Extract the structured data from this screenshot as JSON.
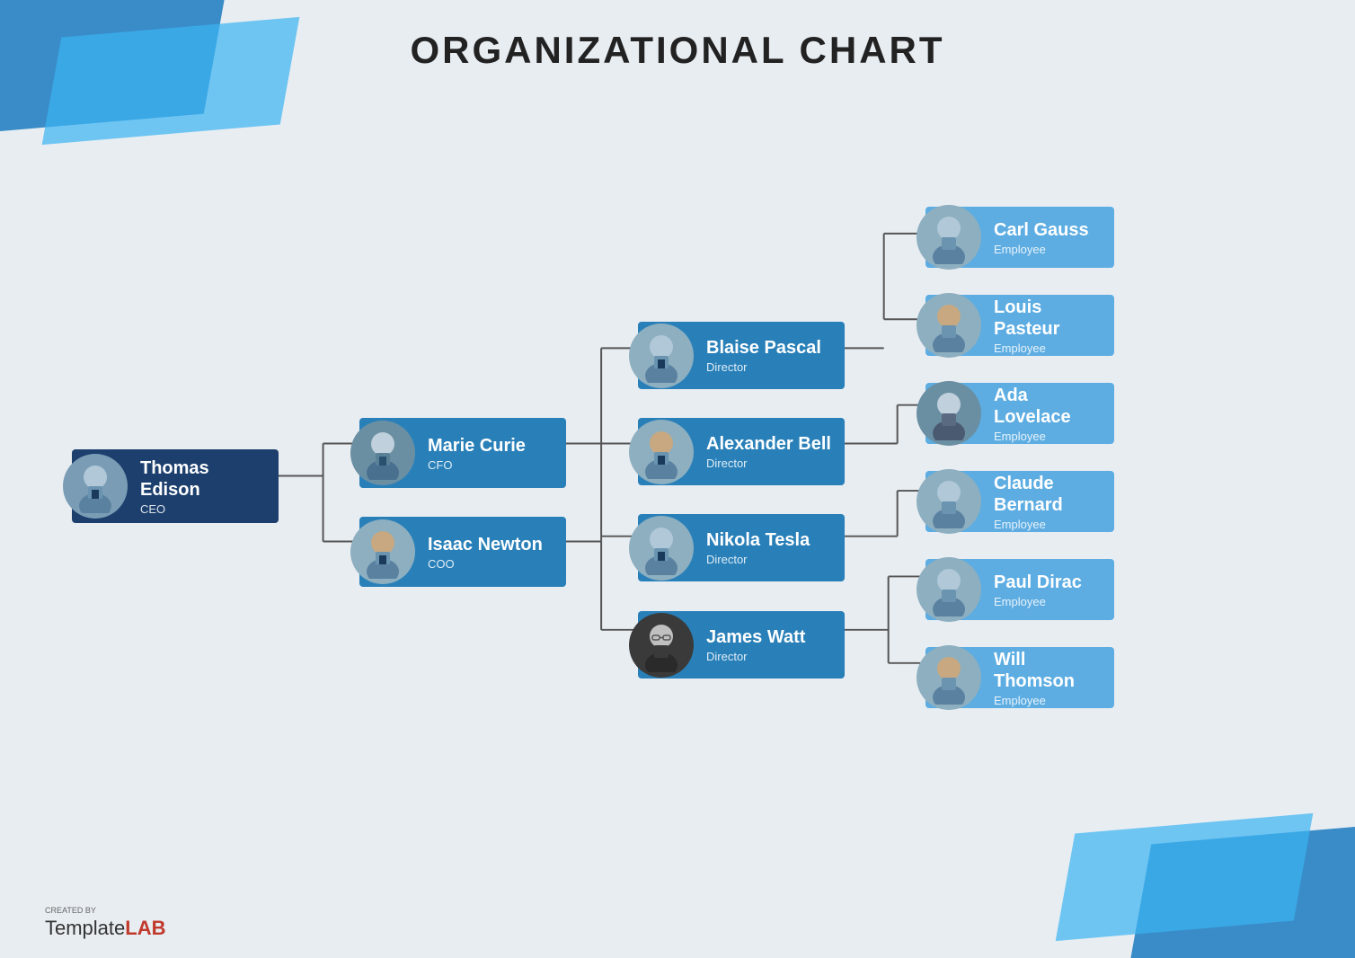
{
  "title": "ORGANIZATIONAL CHART",
  "nodes": {
    "ceo": {
      "name": "Thomas Edison",
      "role": "CEO"
    },
    "cfo": {
      "name": "Marie Curie",
      "role": "CFO"
    },
    "coo": {
      "name": "Isaac Newton",
      "role": "COO"
    },
    "pascal": {
      "name": "Blaise Pascal",
      "role": "Director"
    },
    "bell": {
      "name": "Alexander Bell",
      "role": "Director"
    },
    "tesla": {
      "name": "Nikola Tesla",
      "role": "Director"
    },
    "watt": {
      "name": "James Watt",
      "role": "Director"
    },
    "gauss": {
      "name": "Carl Gauss",
      "role": "Employee"
    },
    "pasteur": {
      "name": "Louis Pasteur",
      "role": "Employee"
    },
    "lovelace": {
      "name": "Ada Lovelace",
      "role": "Employee"
    },
    "bernard": {
      "name": "Claude Bernard",
      "role": "Employee"
    },
    "dirac": {
      "name": "Paul Dirac",
      "role": "Employee"
    },
    "thomson": {
      "name": "Will Thomson",
      "role": "Employee"
    }
  },
  "footer": {
    "created_by": "CREATED BY",
    "template": "Template",
    "lab": "LAB"
  }
}
